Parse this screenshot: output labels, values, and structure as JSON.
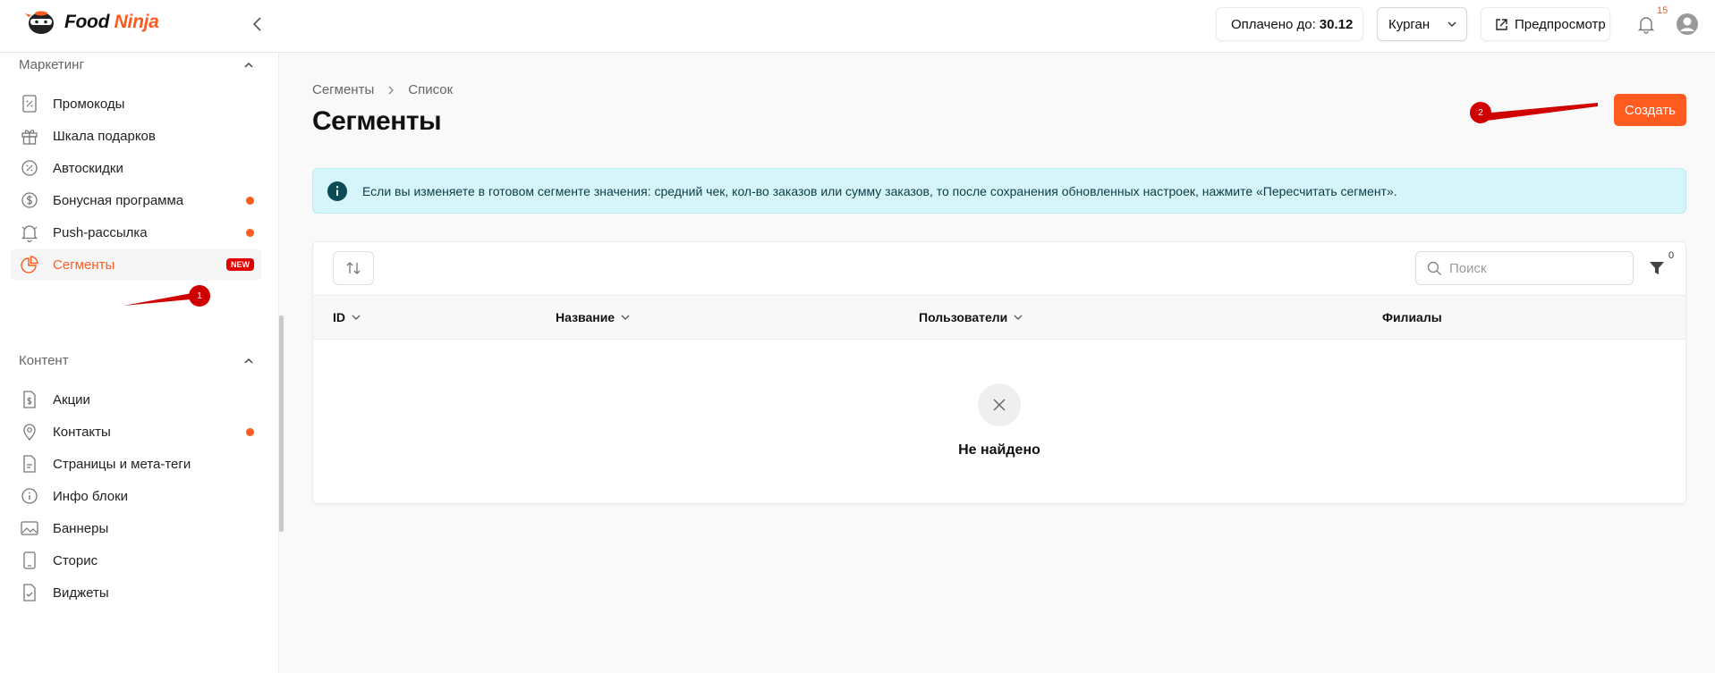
{
  "header": {
    "logo_word1": "Food",
    "logo_word2": "Ninja",
    "paid_label": "Оплачено до:",
    "paid_date": "30.12",
    "city": "Курган",
    "preview_label": "Предпросмотр",
    "notifications_count": "15"
  },
  "sidebar": {
    "marketing": {
      "title": "Маркетинг",
      "items": [
        {
          "label": "Промокоды",
          "icon": "promo-icon"
        },
        {
          "label": "Шкала подарков",
          "icon": "gift-icon"
        },
        {
          "label": "Автоскидки",
          "icon": "discount-icon"
        },
        {
          "label": "Бонусная программа",
          "icon": "coin-icon",
          "dot": true
        },
        {
          "label": "Push-рассылка",
          "icon": "bell-icon",
          "dot": true
        },
        {
          "label": "Сегменты",
          "icon": "pie-icon",
          "badge": "NEW",
          "active": true
        }
      ]
    },
    "content": {
      "title": "Контент",
      "items": [
        {
          "label": "Акции",
          "icon": "dollar-doc-icon"
        },
        {
          "label": "Контакты",
          "icon": "location-icon",
          "dot": true
        },
        {
          "label": "Страницы и мета-теги",
          "icon": "document-icon"
        },
        {
          "label": "Инфо блоки",
          "icon": "info-icon"
        },
        {
          "label": "Баннеры",
          "icon": "image-icon"
        },
        {
          "label": "Сторис",
          "icon": "phone-icon"
        },
        {
          "label": "Виджеты",
          "icon": "check-doc-icon"
        }
      ]
    }
  },
  "annotations": {
    "marker1": "1",
    "marker2": "2"
  },
  "main": {
    "breadcrumb": [
      "Сегменты",
      "Список"
    ],
    "title": "Сегменты",
    "create_label": "Создать",
    "alert_text": "Если вы изменяете в готовом сегменте значения: средний чек, кол-во заказов или сумму заказов, то после сохранения обновленных настроек, нажмите «Пересчитать сегмент».",
    "search_placeholder": "Поиск",
    "filter_count": "0",
    "columns": [
      "ID",
      "Название",
      "Пользователи",
      "Филиалы"
    ],
    "empty_text": "Не найдено"
  },
  "colors": {
    "accent": "#fd5b20",
    "alert_bg": "#d5f5fb",
    "annotation": "#d10000"
  }
}
